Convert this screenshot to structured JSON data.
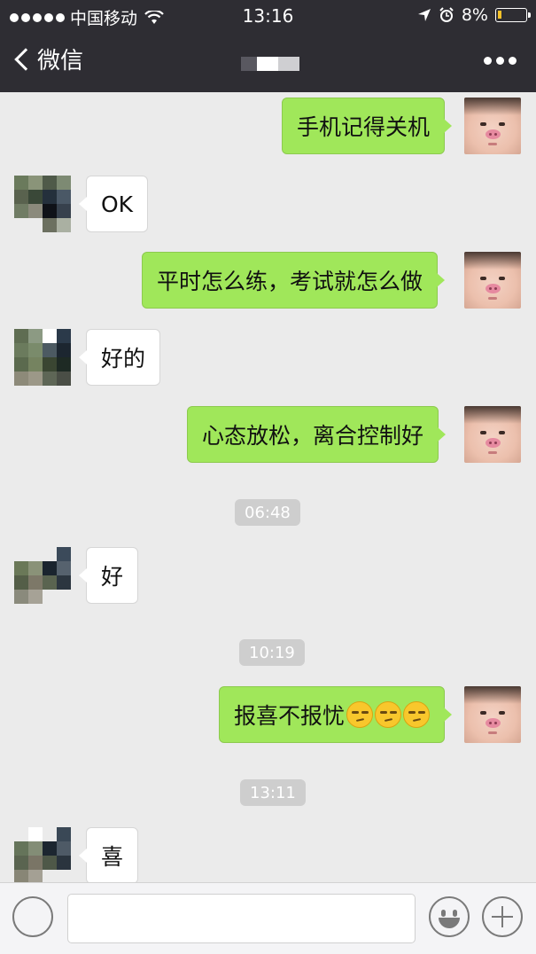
{
  "status_bar": {
    "carrier": "中国移动",
    "time": "13:16",
    "battery": "8%",
    "battery_level": 0.08
  },
  "nav": {
    "back_label": "微信",
    "contact_name_blurred": true,
    "icons": {
      "back": "chevron-left-icon",
      "more": "more-dots-icon"
    }
  },
  "messages": [
    {
      "side": "out",
      "text": "手机记得关机"
    },
    {
      "side": "in",
      "text": "OK"
    },
    {
      "side": "out",
      "text": "平时怎么练，考试就怎么做"
    },
    {
      "side": "in",
      "text": "好的"
    },
    {
      "side": "out",
      "text": "心态放松，离合控制好"
    },
    {
      "side": "in",
      "text": "好"
    },
    {
      "side": "out",
      "text": "报喜不报忧",
      "emoji": [
        "smirk-face-icon",
        "smirk-face-icon",
        "smirk-face-icon"
      ]
    },
    {
      "side": "in",
      "text": "喜"
    }
  ],
  "timestamps": [
    "06:48",
    "10:19",
    "13:11"
  ],
  "input_bar": {
    "icons": {
      "voice": "voice-icon",
      "emoji": "emoji-icon",
      "plus": "plus-icon"
    }
  },
  "colors": {
    "nav_bg": "#2e2d33",
    "chat_bg": "#ebebeb",
    "outgoing_bubble": "#a0e75a",
    "incoming_bubble": "#ffffff",
    "timestamp_bg": "#cecece"
  }
}
